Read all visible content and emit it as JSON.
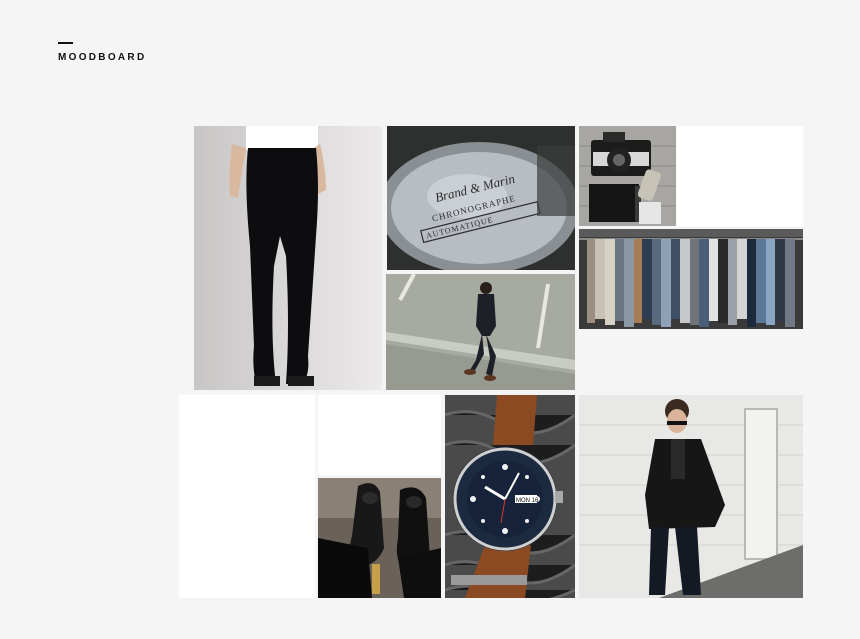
{
  "header": {
    "title": "MOODBOARD"
  },
  "watch_text": {
    "brand": "Brand & Marin",
    "line1": "CHRONOGRAPHE",
    "line2": "AUTOMATIQUE"
  },
  "dial_text": {
    "date": "MON 16"
  }
}
